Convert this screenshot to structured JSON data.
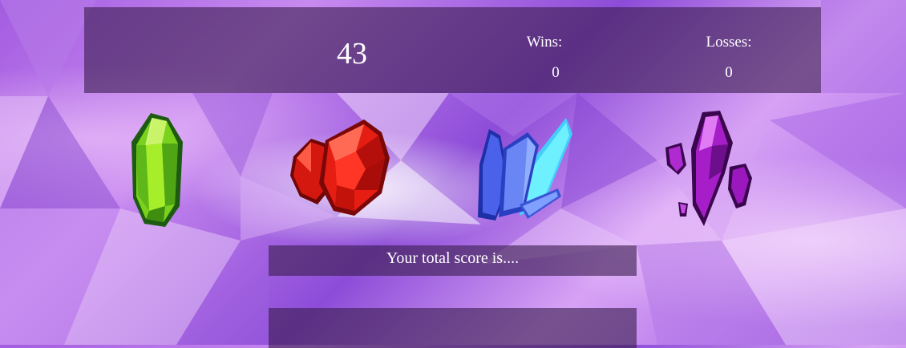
{
  "scoreboard": {
    "target_number": "43",
    "wins_label": "Wins:",
    "wins_value": "0",
    "losses_label": "Losses:",
    "losses_value": "0"
  },
  "crystals": [
    {
      "name": "green crystal",
      "color": "#6fd21a"
    },
    {
      "name": "red crystal",
      "color": "#d11a12"
    },
    {
      "name": "blue crystal",
      "color": "#3d6bff"
    },
    {
      "name": "purple crystal",
      "color": "#9a1bc4"
    }
  ],
  "total_score": {
    "label": "Your total score is....",
    "value": ""
  },
  "colors": {
    "panel": "#3c1e50",
    "background_accent": "#a35ce0",
    "text": "#ffffff"
  }
}
